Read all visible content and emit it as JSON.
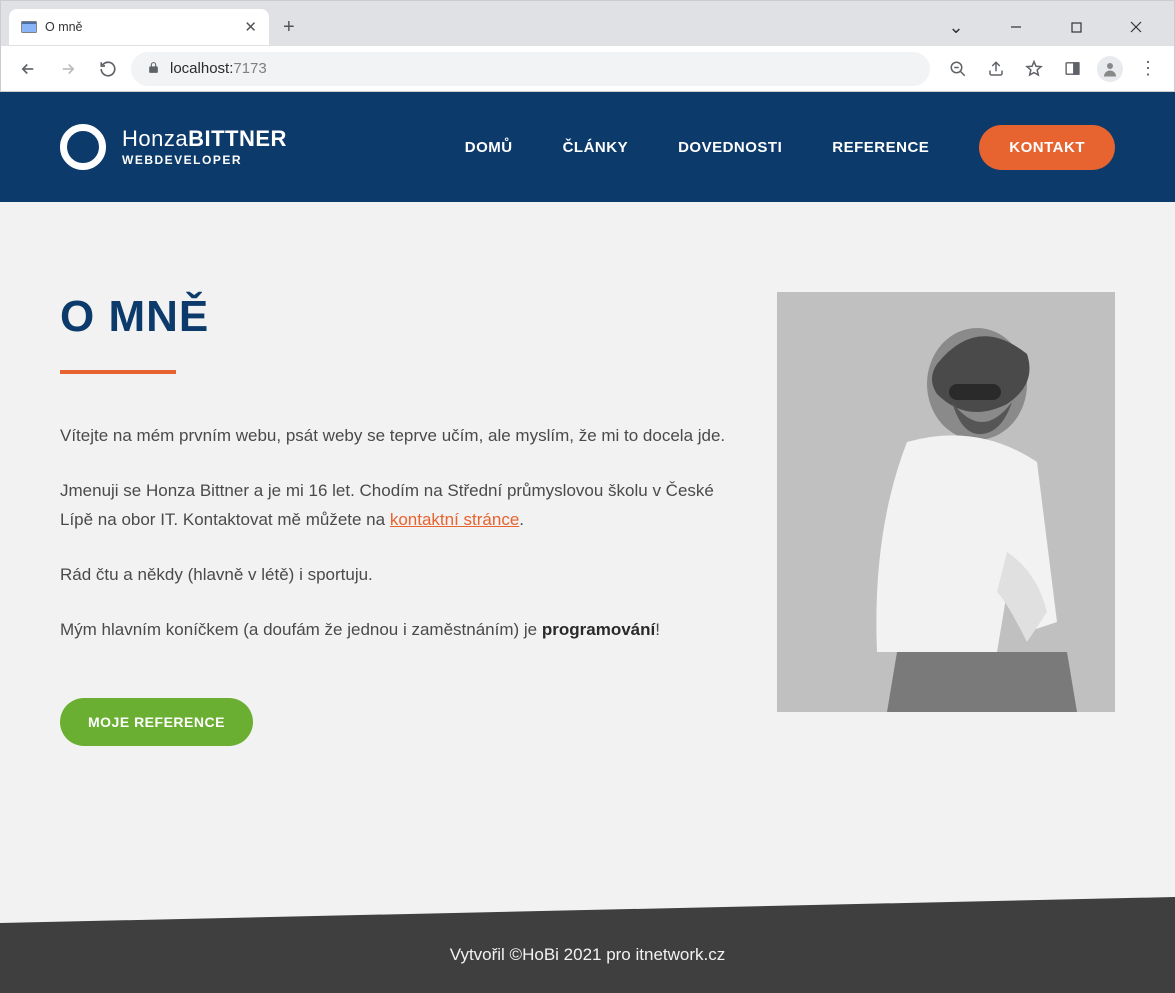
{
  "browser": {
    "tab_title": "O mně",
    "url_host": "localhost:",
    "url_port": "7173"
  },
  "header": {
    "logo_first": "Honza",
    "logo_bold": "BITTNER",
    "logo_sub": "WEBDEVELOPER",
    "nav": {
      "home": "DOMŮ",
      "articles": "ČLÁNKY",
      "skills": "DOVEDNOSTI",
      "refs": "REFERENCE",
      "contact": "KONTAKT"
    }
  },
  "main": {
    "heading": "O MNĚ",
    "p1": "Vítejte na mém prvním webu, psát weby se teprve učím, ale myslím, že mi to docela jde.",
    "p2a": "Jmenuji se Honza Bittner a je mi 16 let. Chodím na Střední průmyslovou školu v České Lípě na obor IT. Kontaktovat mě můžete na ",
    "p2_link": "kontaktní stránce",
    "p2b": ".",
    "p3": "Rád čtu a někdy (hlavně v létě) i sportuju.",
    "p4a": "Mým hlavním koníčkem (a doufám že jednou i zaměstnáním) je ",
    "p4_strong": "programování",
    "p4b": "!",
    "ref_button": "MOJE REFERENCE"
  },
  "footer": {
    "text": "Vytvořil ©HoBi 2021 pro itnetwork.cz"
  }
}
